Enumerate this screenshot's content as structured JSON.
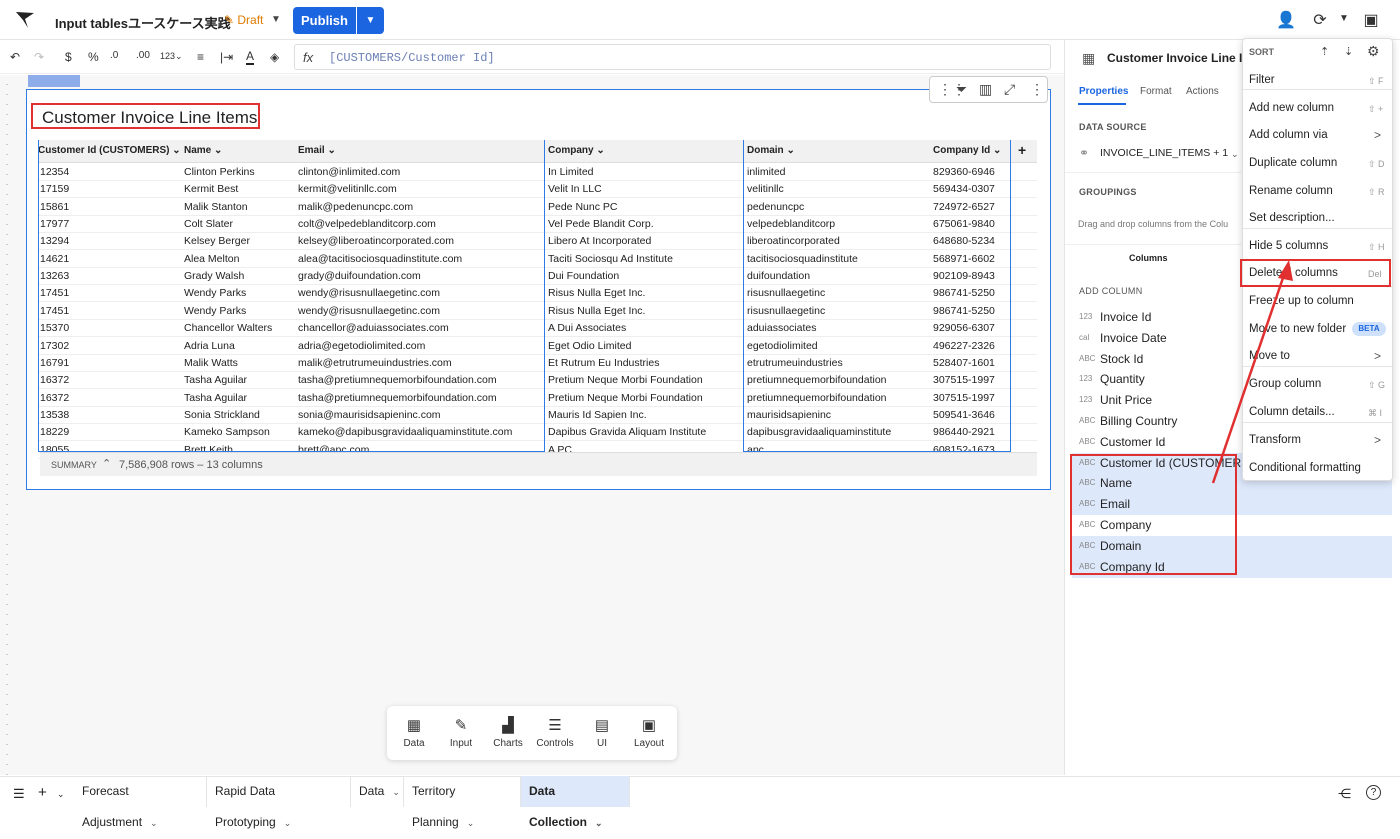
{
  "app": {
    "title": "Input tablesユースケース実践",
    "status": "Draft",
    "publish_label": "Publish"
  },
  "formula": {
    "fx": "fx",
    "text": "[CUSTOMERS/Customer Id]"
  },
  "widget": {
    "title": "Customer Invoice Line Items",
    "columns": [
      "Customer Id (CUSTOMERS)",
      "Name",
      "Email",
      "Company",
      "Domain",
      "Company Id"
    ],
    "rows": [
      [
        "12354",
        "Clinton Perkins",
        "clinton@inlimited.com",
        "In Limited",
        "inlimited",
        "829360-6946"
      ],
      [
        "17159",
        "Kermit Best",
        "kermit@velitinllc.com",
        "Velit In LLC",
        "velitinllc",
        "569434-0307"
      ],
      [
        "15861",
        "Malik Stanton",
        "malik@pedenuncpc.com",
        "Pede Nunc PC",
        "pedenuncpc",
        "724972-6527"
      ],
      [
        "17977",
        "Colt Slater",
        "colt@velpedeblanditcorp.com",
        "Vel Pede Blandit Corp.",
        "velpedeblanditcorp",
        "675061-9840"
      ],
      [
        "13294",
        "Kelsey Berger",
        "kelsey@liberoatincorporated.com",
        "Libero At Incorporated",
        "liberoatincorporated",
        "648680-5234"
      ],
      [
        "14621",
        "Alea Melton",
        "alea@tacitisociosquadinstitute.com",
        "Taciti Sociosqu Ad Institute",
        "tacitisociosquadinstitute",
        "568971-6602"
      ],
      [
        "13263",
        "Grady Walsh",
        "grady@duifoundation.com",
        "Dui Foundation",
        "duifoundation",
        "902109-8943"
      ],
      [
        "17451",
        "Wendy Parks",
        "wendy@risusnullaegetinc.com",
        "Risus Nulla Eget Inc.",
        "risusnullaegetinc",
        "986741-5250"
      ],
      [
        "17451",
        "Wendy Parks",
        "wendy@risusnullaegetinc.com",
        "Risus Nulla Eget Inc.",
        "risusnullaegetinc",
        "986741-5250"
      ],
      [
        "15370",
        "Chancellor Walters",
        "chancellor@aduiassociates.com",
        "A Dui Associates",
        "aduiassociates",
        "929056-6307"
      ],
      [
        "17302",
        "Adria Luna",
        "adria@egetodiolimited.com",
        "Eget Odio Limited",
        "egetodiolimited",
        "496227-2326"
      ],
      [
        "16791",
        "Malik Watts",
        "malik@etrutrumeuindustries.com",
        "Et Rutrum Eu Industries",
        "etrutrumeuindustries",
        "528407-1601"
      ],
      [
        "16372",
        "Tasha Aguilar",
        "tasha@pretiumnequemorbifoundation.com",
        "Pretium Neque Morbi Foundation",
        "pretiumnequemorbifoundation",
        "307515-1997"
      ],
      [
        "16372",
        "Tasha Aguilar",
        "tasha@pretiumnequemorbifoundation.com",
        "Pretium Neque Morbi Foundation",
        "pretiumnequemorbifoundation",
        "307515-1997"
      ],
      [
        "13538",
        "Sonia Strickland",
        "sonia@maurisidsapieninc.com",
        "Mauris Id Sapien Inc.",
        "maurisidsapieninc",
        "509541-3646"
      ],
      [
        "18229",
        "Kameko Sampson",
        "kameko@dapibusgravidaaliquaminstitute.com",
        "Dapibus Gravida Aliquam Institute",
        "dapibusgravidaaliquaminstitute",
        "986440-2921"
      ],
      [
        "18055",
        "Brett Keith",
        "brett@apc.com",
        "A PC",
        "apc",
        "608152-1673"
      ]
    ],
    "summary_label": "SUMMARY",
    "summary_text": "7,586,908 rows – 13 columns"
  },
  "panel": {
    "title": "Customer Invoice Line Iter",
    "tabs": [
      "Properties",
      "Format",
      "Actions"
    ],
    "data_source_label": "DATA SOURCE",
    "data_source_value": "INVOICE_LINE_ITEMS + 1",
    "groupings_label": "GROUPINGS",
    "groupings_hint": "Drag and drop columns from the Colu",
    "columns_header": "Columns",
    "add_column_label": "ADD COLUMN",
    "column_list": [
      {
        "type": "123",
        "name": "Invoice Id"
      },
      {
        "type": "cal",
        "name": "Invoice Date"
      },
      {
        "type": "ABC",
        "name": "Stock Id"
      },
      {
        "type": "123",
        "name": "Quantity"
      },
      {
        "type": "123",
        "name": "Unit Price"
      },
      {
        "type": "ABC",
        "name": "Billing Country"
      },
      {
        "type": "ABC",
        "name": "Customer Id"
      },
      {
        "type": "ABC",
        "name": "Customer Id (CUSTOMERS)"
      },
      {
        "type": "ABC",
        "name": "Name"
      },
      {
        "type": "ABC",
        "name": "Email"
      },
      {
        "type": "ABC",
        "name": "Company"
      },
      {
        "type": "ABC",
        "name": "Domain"
      },
      {
        "type": "ABC",
        "name": "Company Id"
      }
    ]
  },
  "menu": {
    "sort_label": "SORT",
    "items": [
      {
        "label": "Filter",
        "key": "⇧ F"
      },
      {
        "label": "Add new column",
        "key": "⇧ +"
      },
      {
        "label": "Add column via",
        "key": ">"
      },
      {
        "label": "Duplicate column",
        "key": "⇧ D"
      },
      {
        "label": "Rename column",
        "key": "⇧ R"
      },
      {
        "label": "Set description...",
        "key": ""
      },
      {
        "label": "Hide 5 columns",
        "key": "⇧ H"
      },
      {
        "label": "Delete 5 columns",
        "key": "Del"
      },
      {
        "label": "Freeze up to column",
        "key": ""
      },
      {
        "label": "Move to new folder",
        "key": "BETA"
      },
      {
        "label": "Move to",
        "key": ">"
      },
      {
        "label": "Group column",
        "key": "⇧ G"
      },
      {
        "label": "Column details...",
        "key": "⌘ I"
      },
      {
        "label": "Transform",
        "key": ">"
      },
      {
        "label": "Conditional formatting",
        "key": ""
      }
    ]
  },
  "dock": [
    {
      "icon": "table-icon",
      "label": "Data"
    },
    {
      "icon": "input-icon",
      "label": "Input"
    },
    {
      "icon": "chart-icon",
      "label": "Charts"
    },
    {
      "icon": "controls-icon",
      "label": "Controls"
    },
    {
      "icon": "ui-icon",
      "label": "UI"
    },
    {
      "icon": "layout-icon",
      "label": "Layout"
    }
  ],
  "bottom_tabs": [
    "Forecast Adjustment",
    "Rapid Data Prototyping",
    "Data",
    "Territory Planning",
    "Data Collection"
  ],
  "colors": {
    "accent": "#1b66e0",
    "highlight": "#e03030",
    "draft": "#e07b00",
    "selection": "#dde8fb"
  }
}
